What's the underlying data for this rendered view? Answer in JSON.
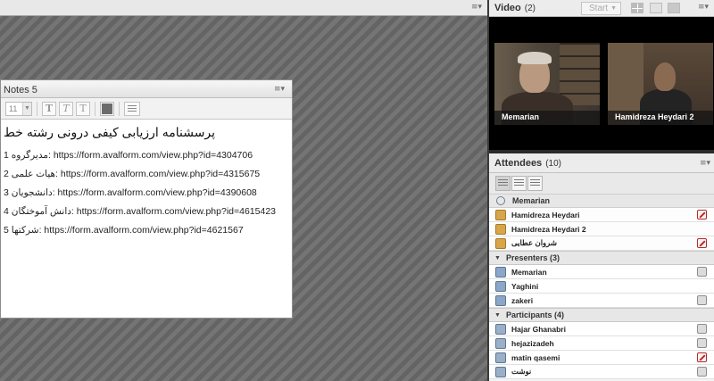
{
  "notes": {
    "title": "Notes 5",
    "font_size": "11",
    "heading": "پرسشنامه ارزیابی کیفی درونی  رشته خط",
    "lines": [
      "1 مدیرگروه: https://form.avalform.com/view.php?id=4304706",
      "2 هیات علمی: https://form.avalform.com/view.php?id=4315675",
      "3 دانشجویان: https://form.avalform.com/view.php?id=4390608",
      "4 دانش آموختگان: https://form.avalform.com/view.php?id=4615423",
      "5 شرکتها: https://form.avalform.com/view.php?id=4621567"
    ],
    "toolbar": {
      "bold": "T",
      "italic": "T",
      "plain": "T"
    }
  },
  "video": {
    "title": "Video",
    "count": "(2)",
    "start_label": "Start",
    "feeds": [
      {
        "name": "Memarian"
      },
      {
        "name": "Hamidreza Heydari 2"
      }
    ]
  },
  "attendees": {
    "title": "Attendees",
    "count": "(10)",
    "hosts_label": "Memarian",
    "hosts": [
      {
        "name": "Hamidreza Heydari",
        "state": "red"
      },
      {
        "name": "Hamidreza Heydari 2",
        "state": ""
      },
      {
        "name": "شروان عطایی",
        "state": "red"
      }
    ],
    "presenters_label": "Presenters (3)",
    "presenters": [
      {
        "name": "Memarian",
        "state": "grey"
      },
      {
        "name": "Yaghini",
        "state": ""
      },
      {
        "name": "zakeri",
        "state": "grey"
      }
    ],
    "participants_label": "Participants (4)",
    "participants": [
      {
        "name": "Hajar Ghanabri",
        "state": "grey"
      },
      {
        "name": "hejazizadeh",
        "state": "grey"
      },
      {
        "name": "matin qasemi",
        "state": "red"
      },
      {
        "name": "نوشت",
        "state": "grey"
      }
    ]
  },
  "icons": {
    "pod_menu": "pod-menu-icon",
    "video_layouts": [
      "grid-layout-icon",
      "single-layout-icon",
      "filmstrip-layout-icon"
    ],
    "attendee_views": [
      "list-view-icon",
      "grid-view-icon",
      "card-view-icon"
    ]
  },
  "colors": {
    "host_icon": "#d7a64a",
    "muted_red": "#c42424",
    "stage_bg": "#6e6e6e"
  }
}
